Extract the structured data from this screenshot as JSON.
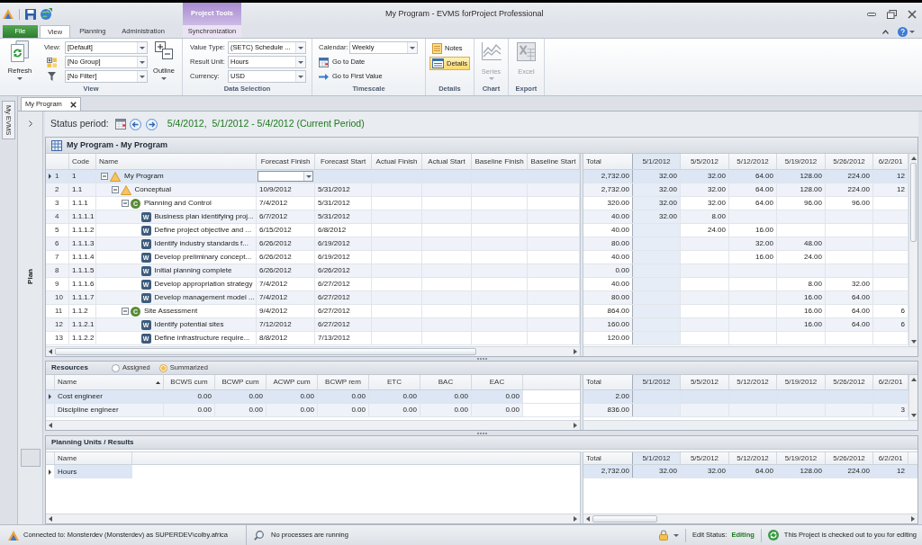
{
  "window": {
    "title": "My Program - EVMS forProject Professional"
  },
  "context_group": {
    "label": "Project Tools"
  },
  "ribbon_tabs": [
    {
      "label": "File",
      "kind": "file",
      "selected": false
    },
    {
      "label": "View",
      "kind": "standard",
      "selected": true
    },
    {
      "label": "Planning",
      "kind": "standard",
      "selected": false
    },
    {
      "label": "Administration",
      "kind": "standard",
      "selected": false
    },
    {
      "label": "Synchronization",
      "kind": "contextual",
      "selected": false
    }
  ],
  "ribbon": {
    "view": {
      "label": "View",
      "refresh": {
        "label": "Refresh"
      },
      "view_field": {
        "label": "View:",
        "value": "[Default]"
      },
      "group_field": {
        "value": "[No Group]"
      },
      "filter_field": {
        "value": "[No Filter]"
      },
      "outline": {
        "label": "Outline"
      }
    },
    "data_selection": {
      "label": "Data Selection",
      "fields": [
        {
          "label": "Value Type:",
          "value": "(SETC) Schedule ..."
        },
        {
          "label": "Result Unit:",
          "value": "Hours"
        },
        {
          "label": "Currency:",
          "value": "USD"
        }
      ]
    },
    "timescale": {
      "label": "Timescale",
      "calendar": {
        "label": "Calendar:",
        "value": "Weekly"
      },
      "go_to_date": {
        "label": "Go to Date"
      },
      "go_to_first": {
        "label": "Go to First Value"
      }
    },
    "details": {
      "label": "Details",
      "buttons": [
        {
          "label": "Notes",
          "kind": "notes",
          "selected": false
        },
        {
          "label": "Details",
          "kind": "details",
          "selected": true
        }
      ]
    },
    "chart": {
      "label": "Chart",
      "series": {
        "label": "Series",
        "disabled": true
      }
    },
    "export": {
      "label": "Export",
      "excel": {
        "label": "Excel",
        "disabled": true
      }
    }
  },
  "side_tab": {
    "label": "My EVMS"
  },
  "document_tab": {
    "label": "My Program"
  },
  "plan_panel": {
    "label": "Plan"
  },
  "status_period": {
    "label": "Status period:",
    "value": "5/4/2012,  5/1/2012 - 5/4/2012 (Current Period)"
  },
  "plan_grid": {
    "title": "My Program - My Program",
    "columns": [
      "Code",
      "Name",
      "Forecast Finish",
      "Forecast Start",
      "Actual Finish",
      "Actual Start",
      "Baseline Finish",
      "Baseline Start"
    ],
    "timeline_columns": [
      {
        "label": "Total",
        "current": false
      },
      {
        "label": "5/1/2012",
        "current": true
      },
      {
        "label": "5/5/2012",
        "current": false
      },
      {
        "label": "5/12/2012",
        "current": false
      },
      {
        "label": "5/19/2012",
        "current": false
      },
      {
        "label": "5/26/2012",
        "current": false
      },
      {
        "label": "6/2/201",
        "current": false
      }
    ],
    "rows": [
      {
        "number": "1",
        "code": "1",
        "name": "My Program",
        "kind": "summary",
        "expanded": true,
        "selected": true,
        "editing": true,
        "total": "2,732.00",
        "period_1": "32.00",
        "period_2": "32.00",
        "period_3": "64.00",
        "period_4": "128.00",
        "period_5": "224.00",
        "period_6": "12",
        "children": [
          {
            "number": "2",
            "code": "1.1",
            "name": "Conceptual",
            "kind": "summary",
            "expanded": true,
            "selected": false,
            "editing": false,
            "forecast_finish": "10/9/2012",
            "forecast_start": "5/31/2012",
            "total": "2,732.00",
            "period_1": "32.00",
            "period_2": "32.00",
            "period_3": "64.00",
            "period_4": "128.00",
            "period_5": "224.00",
            "period_6": "12",
            "children": [
              {
                "number": "3",
                "code": "1.1.1",
                "name": "Planning and Control",
                "kind": "account",
                "badge": "C",
                "expanded": true,
                "selected": false,
                "editing": false,
                "forecast_finish": "7/4/2012",
                "forecast_start": "5/31/2012",
                "total": "320.00",
                "period_1": "32.00",
                "period_2": "32.00",
                "period_3": "64.00",
                "period_4": "96.00",
                "period_5": "96.00",
                "children": [
                  {
                    "number": "4",
                    "code": "1.1.1.1",
                    "name": "Business plan identifying proj...",
                    "kind": "work",
                    "badge": "W",
                    "selected": false,
                    "editing": false,
                    "forecast_finish": "6/7/2012",
                    "forecast_start": "5/31/2012",
                    "total": "40.00",
                    "period_1": "32.00",
                    "period_2": "8.00"
                  },
                  {
                    "number": "5",
                    "code": "1.1.1.2",
                    "name": "Define project objective and ...",
                    "kind": "work",
                    "badge": "W",
                    "selected": false,
                    "editing": false,
                    "forecast_finish": "6/15/2012",
                    "forecast_start": "6/8/2012",
                    "total": "40.00",
                    "period_2": "24.00",
                    "period_3": "16.00"
                  },
                  {
                    "number": "6",
                    "code": "1.1.1.3",
                    "name": "Identify industry standards f...",
                    "kind": "work",
                    "badge": "W",
                    "selected": false,
                    "editing": false,
                    "forecast_finish": "6/26/2012",
                    "forecast_start": "6/19/2012",
                    "total": "80.00",
                    "period_3": "32.00",
                    "period_4": "48.00"
                  },
                  {
                    "number": "7",
                    "code": "1.1.1.4",
                    "name": "Develop preliminary concept...",
                    "kind": "work",
                    "badge": "W",
                    "selected": false,
                    "editing": false,
                    "forecast_finish": "6/26/2012",
                    "forecast_start": "6/19/2012",
                    "total": "40.00",
                    "period_3": "16.00",
                    "period_4": "24.00"
                  },
                  {
                    "number": "8",
                    "code": "1.1.1.5",
                    "name": "Initial planning complete",
                    "kind": "work",
                    "badge": "W",
                    "selected": false,
                    "editing": false,
                    "forecast_finish": "6/26/2012",
                    "forecast_start": "6/26/2012",
                    "total": "0.00"
                  },
                  {
                    "number": "9",
                    "code": "1.1.1.6",
                    "name": "Develop appropriation strategy",
                    "kind": "work",
                    "badge": "W",
                    "selected": false,
                    "editing": false,
                    "forecast_finish": "7/4/2012",
                    "forecast_start": "6/27/2012",
                    "total": "40.00",
                    "period_4": "8.00",
                    "period_5": "32.00"
                  },
                  {
                    "number": "10",
                    "code": "1.1.1.7",
                    "name": "Develop management model ...",
                    "kind": "work",
                    "badge": "W",
                    "selected": false,
                    "editing": false,
                    "forecast_finish": "7/4/2012",
                    "forecast_start": "6/27/2012",
                    "total": "80.00",
                    "period_4": "16.00",
                    "period_5": "64.00"
                  }
                ]
              },
              {
                "number": "11",
                "code": "1.1.2",
                "name": "Site Assessment",
                "kind": "account",
                "badge": "C",
                "expanded": true,
                "selected": false,
                "editing": false,
                "forecast_finish": "9/4/2012",
                "forecast_start": "6/27/2012",
                "total": "864.00",
                "period_4": "16.00",
                "period_5": "64.00",
                "period_6": "6",
                "children": [
                  {
                    "number": "12",
                    "code": "1.1.2.1",
                    "name": "Identify potential sites",
                    "kind": "work",
                    "badge": "W",
                    "selected": false,
                    "editing": false,
                    "forecast_finish": "7/12/2012",
                    "forecast_start": "6/27/2012",
                    "total": "160.00",
                    "period_4": "16.00",
                    "period_5": "64.00",
                    "period_6": "6"
                  },
                  {
                    "number": "13",
                    "code": "1.1.2.2",
                    "name": "Define infrastructure require...",
                    "kind": "work",
                    "badge": "W",
                    "selected": false,
                    "editing": false,
                    "forecast_finish": "8/8/2012",
                    "forecast_start": "7/13/2012",
                    "total": "120.00"
                  }
                ]
              }
            ]
          }
        ]
      }
    ]
  },
  "resources": {
    "title": "Resources",
    "modes": [
      {
        "label": "Assigned",
        "selected": false
      },
      {
        "label": "Summarized",
        "selected": true
      }
    ],
    "columns": [
      {
        "label": "Name",
        "sorted": true
      },
      {
        "label": "BCWS cum",
        "sorted": false
      },
      {
        "label": "BCWP cum",
        "sorted": false
      },
      {
        "label": "ACWP cum",
        "sorted": false
      },
      {
        "label": "BCWP rem",
        "sorted": false
      },
      {
        "label": "ETC",
        "sorted": false
      },
      {
        "label": "BAC",
        "sorted": false
      },
      {
        "label": "EAC",
        "sorted": false
      }
    ],
    "timeline_columns": [
      {
        "label": "Total",
        "current": false
      },
      {
        "label": "5/1/2012",
        "current": true
      },
      {
        "label": "5/5/2012",
        "current": false
      },
      {
        "label": "5/12/2012",
        "current": false
      },
      {
        "label": "5/19/2012",
        "current": false
      },
      {
        "label": "5/26/2012",
        "current": false
      },
      {
        "label": "6/2/201",
        "current": false
      }
    ],
    "rows": [
      {
        "name": "Cost engineer",
        "selected": true,
        "values": [
          "0.00",
          "0.00",
          "0.00",
          "0.00",
          "0.00",
          "0.00",
          "0.00"
        ],
        "total": "2.00"
      },
      {
        "name": "Discipline engineer",
        "selected": false,
        "values": [
          "0.00",
          "0.00",
          "0.00",
          "0.00",
          "0.00",
          "0.00",
          "0.00"
        ],
        "total": "836.00",
        "period_6": "3"
      }
    ]
  },
  "planning_units": {
    "title": "Planning Units / Results",
    "name_column": "Name",
    "timeline_columns": [
      {
        "label": "Total",
        "current": false
      },
      {
        "label": "5/1/2012",
        "current": true
      },
      {
        "label": "5/5/2012",
        "current": false
      },
      {
        "label": "5/12/2012",
        "current": false
      },
      {
        "label": "5/19/2012",
        "current": false
      },
      {
        "label": "5/26/2012",
        "current": false
      },
      {
        "label": "6/2/201",
        "current": false
      }
    ],
    "rows": [
      {
        "name": "Hours",
        "selected": true,
        "total": "2,732.00",
        "period_1": "32.00",
        "period_2": "32.00",
        "period_3": "64.00",
        "period_4": "128.00",
        "period_5": "224.00",
        "period_6": "12"
      }
    ]
  },
  "status_bar": {
    "connection": "Connected to: Monsterdev (Monsterdev) as SUPERDEV\\colby.africa",
    "processes": "No processes are running",
    "edit_status_label": "Edit Status:",
    "edit_status": "Editing",
    "checkout": "This Project is checked out to you for editing"
  }
}
